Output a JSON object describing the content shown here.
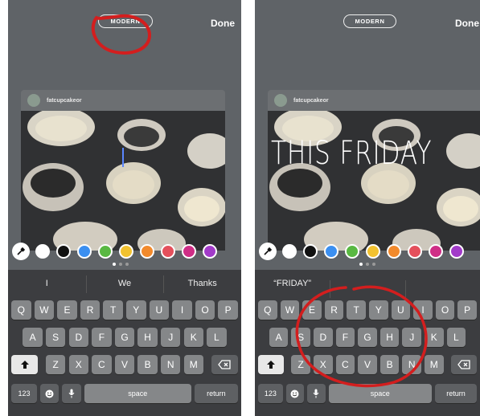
{
  "colors": {
    "palette": [
      "#ffffff",
      "#111111",
      "#3b8ff0",
      "#59b842",
      "#f2c230",
      "#f28a2c",
      "#e4505c",
      "#cf2e86",
      "#a23bc9"
    ],
    "annotation": "#d31e1e",
    "cursor": "#5a86ff"
  },
  "left": {
    "mode_label": "MODERN",
    "done_label": "Done",
    "username": "fatcupcakeor",
    "overlay_text": "",
    "suggestions": [
      "I",
      "We",
      "Thanks"
    ]
  },
  "right": {
    "mode_label": "MODERN",
    "done_label": "Done",
    "username": "fatcupcakeor",
    "overlay_text": "THIS FRIDAY",
    "suggestions": [
      "“FRIDAY”",
      "",
      ""
    ]
  },
  "keyboard": {
    "row1": [
      "Q",
      "W",
      "E",
      "R",
      "T",
      "Y",
      "U",
      "I",
      "O",
      "P"
    ],
    "row2": [
      "A",
      "S",
      "D",
      "F",
      "G",
      "H",
      "J",
      "K",
      "L"
    ],
    "row3": [
      "Z",
      "X",
      "C",
      "V",
      "B",
      "N",
      "M"
    ],
    "numbers_label": "123",
    "space_label": "space",
    "return_label": "return"
  },
  "icons": {
    "pen": "eyedropper-icon",
    "shift": "shift-arrow-icon",
    "delete": "backspace-icon",
    "emoji": "emoji-icon",
    "mic": "microphone-icon"
  }
}
